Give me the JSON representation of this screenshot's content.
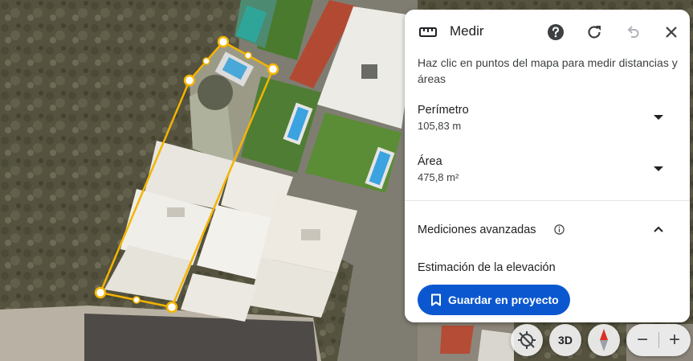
{
  "panel": {
    "title": "Medir",
    "icons": {
      "ruler": "ruler-icon",
      "help": "help-icon",
      "reset": "refresh-icon",
      "undo": "undo-icon",
      "close": "close-icon"
    },
    "instructions": "Haz clic en puntos del mapa para medir distancias y áreas",
    "perimeter": {
      "label": "Perímetro",
      "value": "105,83 m"
    },
    "area": {
      "label": "Área",
      "value": "475,8 m²"
    },
    "advanced": {
      "label": "Mediciones avanzadas"
    },
    "elevation_label": "Estimación de la elevación",
    "save_label": "Guardar en proyecto",
    "accent": "#0b57d0"
  },
  "map_controls": {
    "view3d_label": "3D",
    "zoom_out_label": "−",
    "zoom_in_label": "+",
    "icons": {
      "orientation": "orientation-off-icon",
      "compass": "compass-icon"
    }
  },
  "measure_style": {
    "line_color": "#f4b400",
    "vertex_fill": "#ffffff"
  }
}
